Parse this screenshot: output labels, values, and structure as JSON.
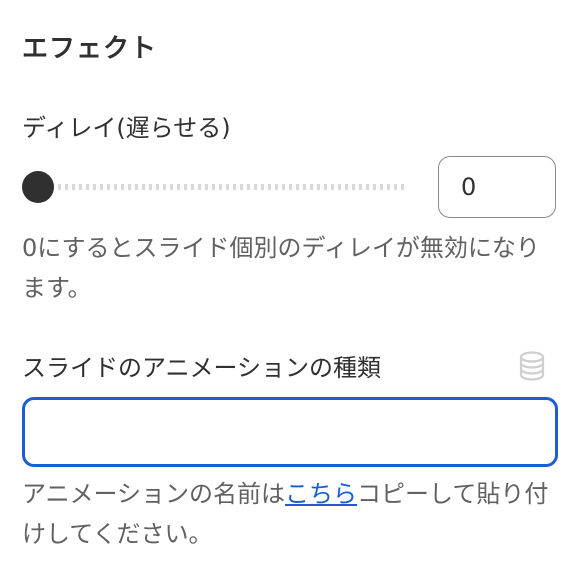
{
  "section": {
    "title": "エフェクト"
  },
  "delay": {
    "label": "ディレイ(遅らせる)",
    "slider_value": 0,
    "input_value": "0",
    "help": "0にするとスライド個別のディレイが無効になります。"
  },
  "animation": {
    "label": "スライドのアニメーションの種類",
    "icon": "database-icon",
    "input_value": "",
    "help_before": "アニメーションの名前は",
    "help_link": "こちら",
    "help_after": "コピーして貼り付けしてください。"
  },
  "colors": {
    "text": "#303030",
    "help_text": "#616161",
    "focus_border": "#1a5fd1",
    "link": "#1a5fd1"
  }
}
